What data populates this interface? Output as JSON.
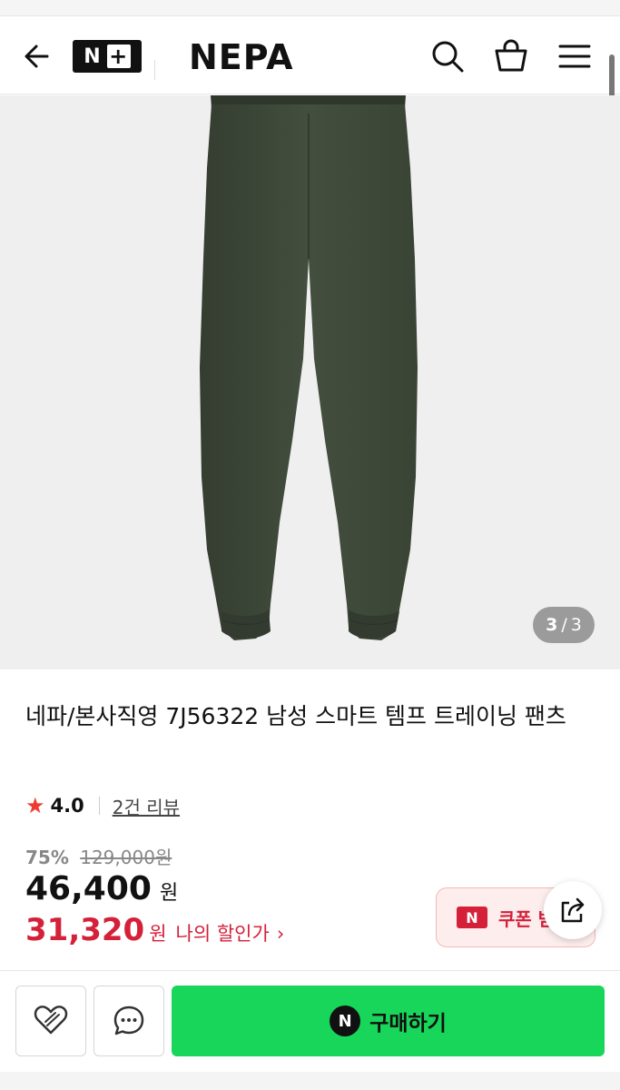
{
  "header": {
    "back_icon": "arrow-left-icon",
    "nplus_label": "N",
    "nplus_plus": "+",
    "brand": "NEPA",
    "search_icon": "search-icon",
    "cart_icon": "shopping-bag-icon",
    "menu_icon": "hamburger-menu-icon"
  },
  "gallery": {
    "current": "3",
    "separator": "/",
    "total": "3"
  },
  "product": {
    "title": "네파/본사직영 7J56322 남성 스마트 템프 트레이닝 팬츠",
    "rating": "4.0",
    "reviews": "2건 리뷰"
  },
  "price": {
    "discount_rate": "75%",
    "original": "129,000원",
    "sale": "46,400",
    "won": "원",
    "my_price": "31,320",
    "my_label": "나의 할인가",
    "my_chevron": "›"
  },
  "coupon": {
    "badge": "N",
    "label": "쿠폰 받기"
  },
  "actions": {
    "wish_icon": "heart-icon",
    "chat_icon": "chat-bubble-icon",
    "share_icon": "share-icon",
    "buy_badge": "N",
    "buy_label": "구매하기"
  },
  "colors": {
    "accent_red": "#d5203a",
    "buy_green": "#18d65a",
    "star": "#ee3a2f",
    "pants": "#3f4a3a"
  }
}
